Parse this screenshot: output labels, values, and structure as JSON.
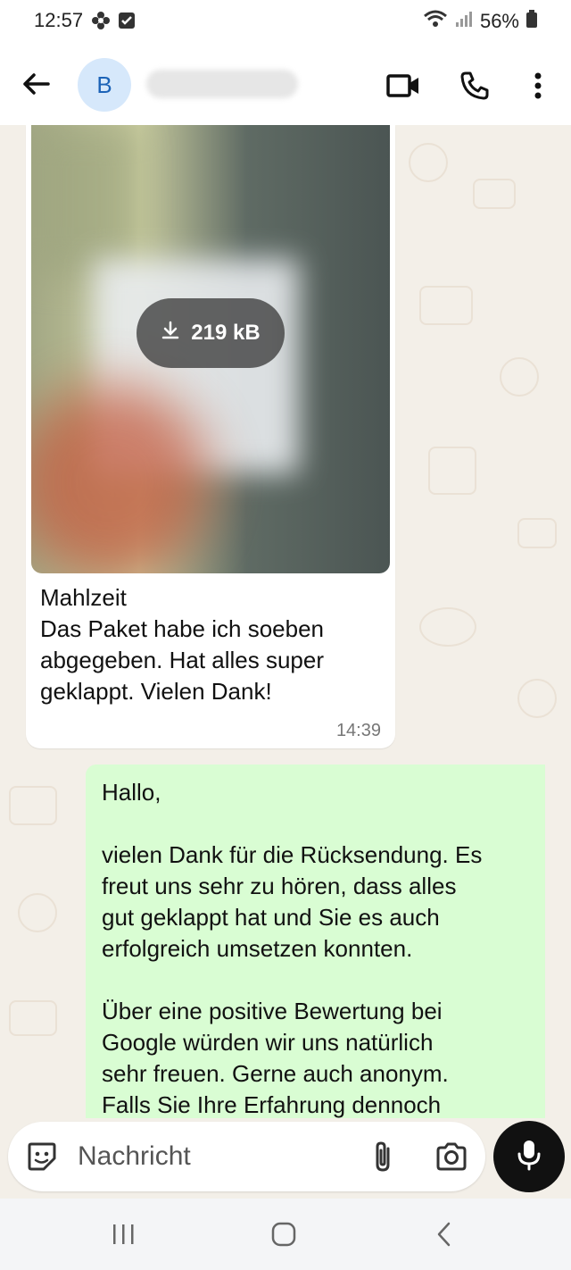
{
  "status_bar": {
    "time": "12:57",
    "battery": "56%",
    "icons": [
      "flower-icon",
      "checkbox-notification-icon",
      "wifi-icon",
      "signal-icon",
      "battery-icon"
    ]
  },
  "header": {
    "avatar_letter": "B",
    "contact_name_blurred": true,
    "icons": [
      "back-arrow-icon",
      "video-call-icon",
      "phone-call-icon",
      "more-options-icon"
    ]
  },
  "messages": {
    "incoming": {
      "download_size": "219 kB",
      "caption_lines": [
        "Mahlzeit",
        "Das Paket habe ich soeben",
        "abgegeben.  Hat alles super",
        "geklappt.  Vielen Dank!"
      ],
      "time": "14:39"
    },
    "outgoing": {
      "greeting": "Hallo,",
      "paragraph1": [
        "vielen Dank für die Rücksendung. Es",
        "freut uns sehr zu hören, dass alles",
        "gut geklappt hat und Sie es auch",
        "erfolgreich umsetzen konnten."
      ],
      "paragraph2": [
        "Über eine positive Bewertung bei",
        "Google würden wir uns natürlich",
        "sehr freuen. Gerne auch anonym.",
        "Falls Sie Ihre Erfahrung dennoch"
      ]
    }
  },
  "composer": {
    "placeholder": "Nachricht",
    "icons": [
      "emoji-sticker-icon",
      "attachment-icon",
      "camera-icon",
      "microphone-icon"
    ]
  },
  "navigation": {
    "icons": [
      "recents-icon",
      "home-icon",
      "back-icon"
    ]
  },
  "colors": {
    "chat_background": "#f3efe8",
    "outgoing_bubble": "#d9fdd3",
    "incoming_bubble": "#ffffff",
    "avatar_background": "#d6e8fb",
    "avatar_text": "#1c63b7"
  }
}
